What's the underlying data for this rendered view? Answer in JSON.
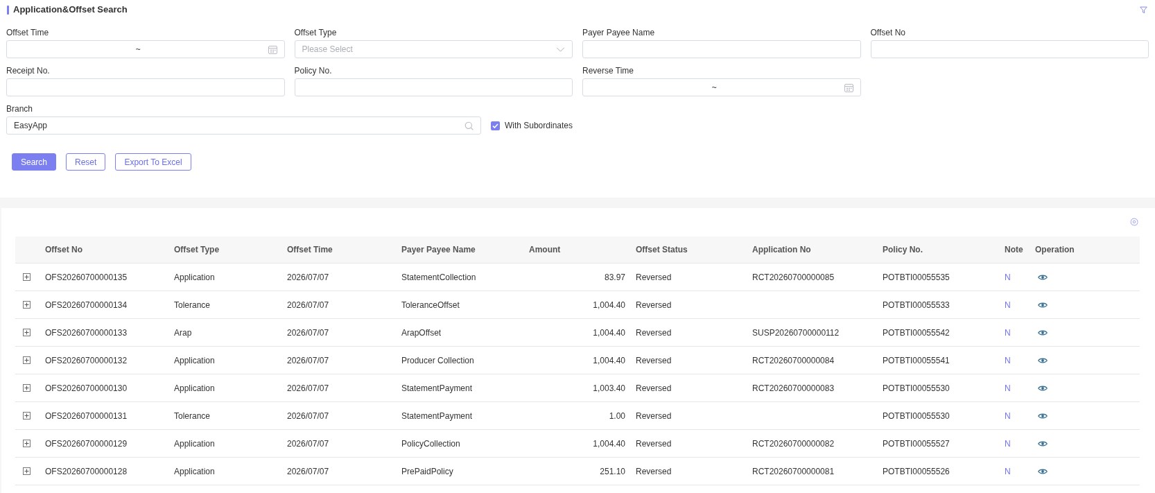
{
  "header": {
    "title": "Application&Offset Search"
  },
  "filters": [
    {
      "kind": "date_range",
      "label": "Offset Time",
      "separator": "~"
    },
    {
      "kind": "select",
      "label": "Offset Type",
      "placeholder": "Please Select"
    },
    {
      "kind": "text",
      "label": "Payer Payee Name"
    },
    {
      "kind": "text",
      "label": "Offset No"
    },
    {
      "kind": "text",
      "label": "Receipt No."
    },
    {
      "kind": "text",
      "label": "Policy No."
    },
    {
      "kind": "date_range",
      "label": "Reverse Time",
      "separator": "~"
    }
  ],
  "branch": {
    "label": "Branch",
    "value": "EasyApp",
    "with_subordinates": {
      "label": "With Subordinates",
      "checked": true
    }
  },
  "buttons": [
    {
      "label": "Search",
      "kind": "primary"
    },
    {
      "label": "Reset",
      "kind": "outline"
    },
    {
      "label": "Export To Excel",
      "kind": "outline"
    }
  ],
  "table": {
    "columns": [
      "Offset No",
      "Offset Type",
      "Offset Time",
      "Payer Payee Name",
      "Amount",
      "Offset Status",
      "Application No",
      "Policy No.",
      "Note",
      "Operation"
    ],
    "rows": [
      {
        "expanded": false,
        "offset_no": "OFS20260700000135",
        "offset_type": "Application",
        "offset_time": "2026/07/07",
        "payer_payee_name": "StatementCollection",
        "amount": "83.97",
        "offset_status": "Reversed",
        "application_no": "RCT20260700000085",
        "policy_no": "POTBTI00055535",
        "note": "N"
      },
      {
        "expanded": false,
        "offset_no": "OFS20260700000134",
        "offset_type": "Tolerance",
        "offset_time": "2026/07/07",
        "payer_payee_name": "ToleranceOffset",
        "amount": "1,004.40",
        "offset_status": "Reversed",
        "policy_no": "POTBTI00055533",
        "note": "N"
      },
      {
        "expanded": false,
        "offset_no": "OFS20260700000133",
        "offset_type": "Arap",
        "offset_time": "2026/07/07",
        "payer_payee_name": "ArapOffset",
        "amount": "1,004.40",
        "offset_status": "Reversed",
        "application_no": "SUSP20260700000112",
        "policy_no": "POTBTI00055542",
        "note": "N"
      },
      {
        "expanded": false,
        "offset_no": "OFS20260700000132",
        "offset_type": "Application",
        "offset_time": "2026/07/07",
        "payer_payee_name": "Producer Collection",
        "amount": "1,004.40",
        "offset_status": "Reversed",
        "application_no": "RCT20260700000084",
        "policy_no": "POTBTI00055541",
        "note": "N"
      },
      {
        "expanded": false,
        "offset_no": "OFS20260700000130",
        "offset_type": "Application",
        "offset_time": "2026/07/07",
        "payer_payee_name": "StatementPayment",
        "amount": "1,003.40",
        "offset_status": "Reversed",
        "application_no": "RCT20260700000083",
        "policy_no": "POTBTI00055530",
        "note": "N"
      },
      {
        "expanded": false,
        "offset_no": "OFS20260700000131",
        "offset_type": "Tolerance",
        "offset_time": "2026/07/07",
        "payer_payee_name": "StatementPayment",
        "amount": "1.00",
        "offset_status": "Reversed",
        "policy_no": "POTBTI00055530",
        "note": "N"
      },
      {
        "expanded": false,
        "offset_no": "OFS20260700000129",
        "offset_type": "Application",
        "offset_time": "2026/07/07",
        "payer_payee_name": "PolicyCollection",
        "amount": "1,004.40",
        "offset_status": "Reversed",
        "application_no": "RCT20260700000082",
        "policy_no": "POTBTI00055527",
        "note": "N"
      },
      {
        "expanded": false,
        "offset_no": "OFS20260700000128",
        "offset_type": "Application",
        "offset_time": "2026/07/07",
        "payer_payee_name": "PrePaidPolicy",
        "amount": "251.10",
        "offset_status": "Reversed",
        "application_no": "RCT20260700000081",
        "policy_no": "POTBTI00055526",
        "note": "N"
      }
    ]
  }
}
